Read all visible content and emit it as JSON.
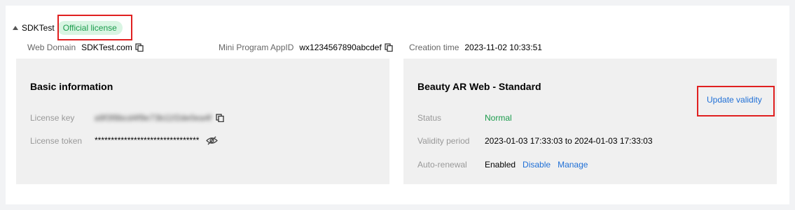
{
  "header": {
    "app_name": "SDKTest",
    "badge": "Official license"
  },
  "meta": {
    "web_domain_label": "Web Domain",
    "web_domain_value": "SDKTest.com",
    "mini_program_label": "Mini Program AppID",
    "mini_program_value": "wx1234567890abcdef",
    "creation_label": "Creation time",
    "creation_value": "2023-11-02 10:33:51"
  },
  "basic": {
    "title": "Basic information",
    "license_key_label": "License key",
    "license_key_value": "a9f3f8bcd4f9e73b11f2de0ea4f",
    "license_token_label": "License token",
    "license_token_value": "********************************"
  },
  "product": {
    "title": "Beauty AR Web - Standard",
    "update_link": "Update validity",
    "status_label": "Status",
    "status_value": "Normal",
    "validity_label": "Validity period",
    "validity_value": "2023-01-03 17:33:03 to 2024-01-03 17:33:03",
    "renewal_label": "Auto-renewal",
    "renewal_value": "Enabled",
    "disable_link": "Disable",
    "manage_link": "Manage"
  },
  "colors": {
    "status_green": "#1a9b4b",
    "link_blue": "#1f6fd6",
    "highlight_red": "#e02020",
    "badge_bg": "#d9f5e3"
  }
}
